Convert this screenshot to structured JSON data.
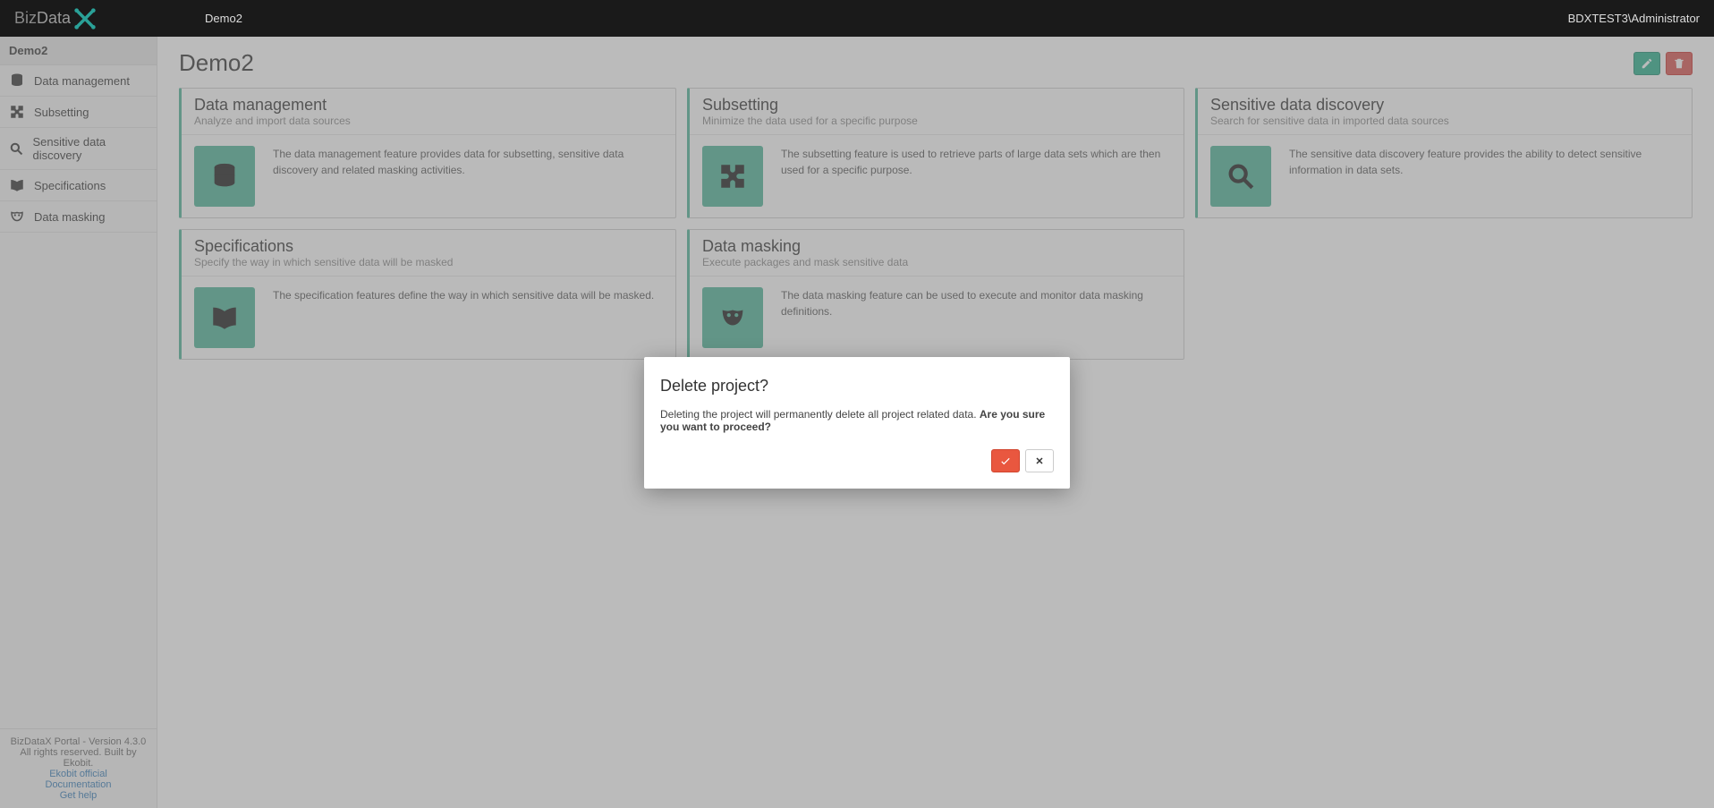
{
  "topbar": {
    "logo_text_1": "Biz",
    "logo_text_2": "Data",
    "project_name": "Demo2",
    "user_label": "BDXTEST3\\Administrator"
  },
  "sidebar": {
    "header": "Demo2",
    "items": [
      {
        "label": "Data management"
      },
      {
        "label": "Subsetting"
      },
      {
        "label": "Sensitive data discovery"
      },
      {
        "label": "Specifications"
      },
      {
        "label": "Data masking"
      }
    ],
    "footer": {
      "line1": "BizDataX Portal - Version 4.3.0",
      "line2": "All rights reserved. Built by Ekobit.",
      "link1": "Ekobit official",
      "link2": "Documentation",
      "link3": "Get help"
    }
  },
  "main": {
    "title": "Demo2",
    "cards": [
      {
        "title": "Data management",
        "sub": "Analyze and import data sources",
        "desc": "The data management feature provides data for subsetting, sensitive data discovery and related masking activities."
      },
      {
        "title": "Subsetting",
        "sub": "Minimize the data used for a specific purpose",
        "desc": "The subsetting feature is used to retrieve parts of large data sets which are then used for a specific purpose."
      },
      {
        "title": "Sensitive data discovery",
        "sub": "Search for sensitive data in imported data sources",
        "desc": "The sensitive data discovery feature provides the ability to detect sensitive information in data sets."
      },
      {
        "title": "Specifications",
        "sub": "Specify the way in which sensitive data will be masked",
        "desc": "The specification features define the way in which sensitive data will be masked."
      },
      {
        "title": "Data masking",
        "sub": "Execute packages and mask sensitive data",
        "desc": "The data masking feature can be used to execute and monitor data masking definitions."
      }
    ]
  },
  "modal": {
    "title": "Delete project?",
    "body_prefix": "Deleting the project will permanently delete all project related data. ",
    "body_strong": "Are you sure you want to proceed?"
  }
}
